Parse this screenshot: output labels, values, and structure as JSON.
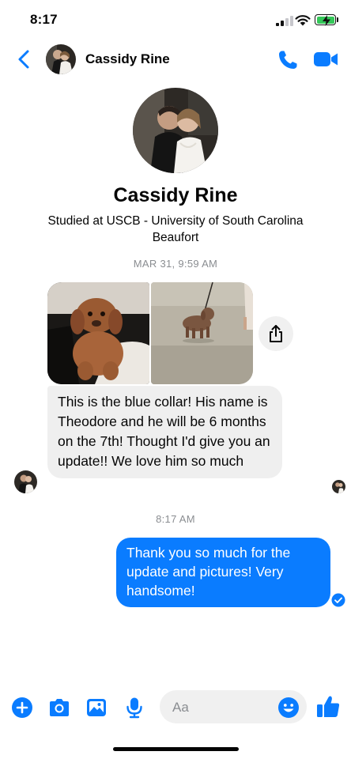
{
  "status_bar": {
    "time": "8:17"
  },
  "header": {
    "contact_name": "Cassidy Rine"
  },
  "profile": {
    "name": "Cassidy Rine",
    "subtitle": "Studied at USCB - University of South Carolina Beaufort"
  },
  "thread": {
    "timestamp_1": "MAR 31, 9:59 AM",
    "incoming_message": "This is the blue collar! His name is Theodore and he will be 6 months on the 7th! Thought I'd give you an update!! We love him so much",
    "timestamp_2": "8:17 AM",
    "outgoing_message": "Thank you so much for the update and pictures! Very handsome!"
  },
  "composer": {
    "placeholder": "Aa"
  },
  "colors": {
    "accent": "#0a7cff",
    "incoming_bubble": "#efefef",
    "timestamp_gray": "#8a8d91",
    "battery_green": "#34c759"
  },
  "icons": [
    "back-chevron-icon",
    "phone-icon",
    "video-camera-icon",
    "share-icon",
    "plus-icon",
    "camera-icon",
    "gallery-icon",
    "microphone-icon",
    "emoji-icon",
    "thumbs-up-icon",
    "sent-check-icon"
  ]
}
